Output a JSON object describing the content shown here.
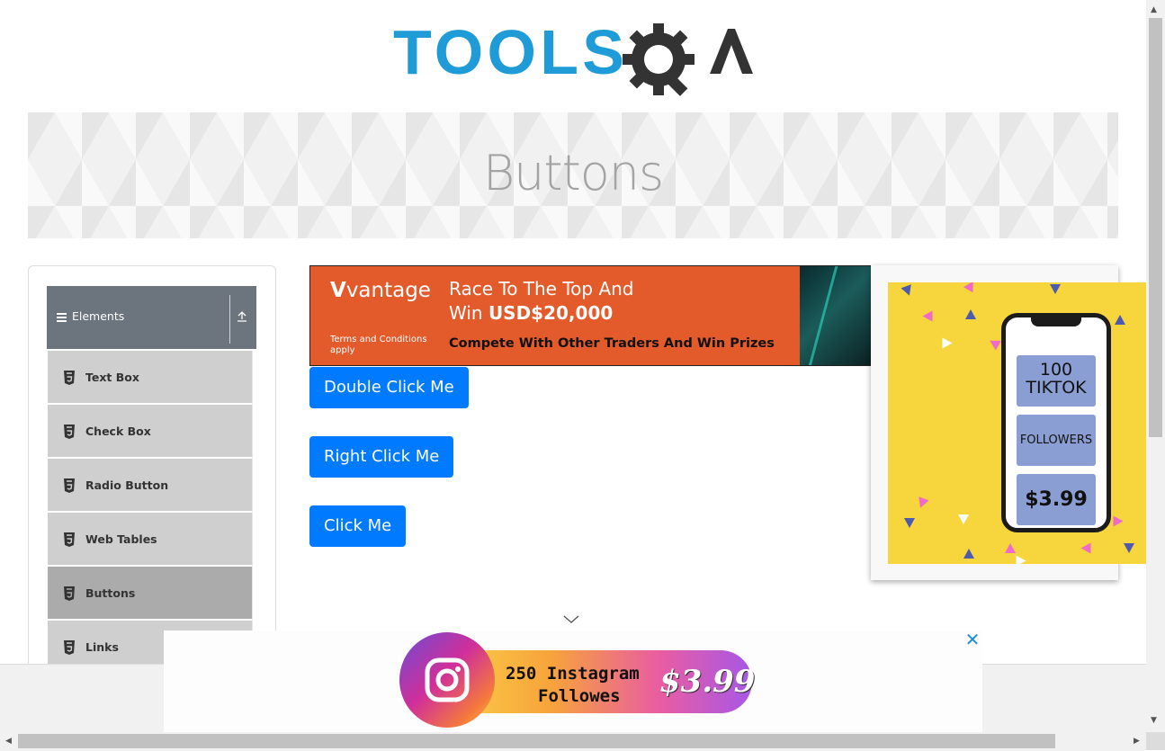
{
  "header": {
    "logo_text": "TOOLSQA"
  },
  "banner": {
    "title": "Buttons"
  },
  "sidebar": {
    "group": {
      "label": "Elements"
    },
    "items": [
      {
        "label": "Text Box"
      },
      {
        "label": "Check Box"
      },
      {
        "label": "Radio Button"
      },
      {
        "label": "Web Tables"
      },
      {
        "label": "Buttons",
        "active": true
      },
      {
        "label": "Links"
      }
    ]
  },
  "ads": {
    "vantage": {
      "brand": "vantage",
      "headline_line1": "Race To The Top And",
      "headline_line2_prefix": "Win ",
      "headline_line2_bold": "USD$20,000",
      "terms": "Terms and Conditions apply",
      "subline": "Compete With Other Traders And Win Prizes"
    },
    "tiktok": {
      "line1": "100",
      "line2": "TIKTOK",
      "card2": "FOLLOWERS",
      "price": "$3.99"
    },
    "instagram": {
      "text_line1": "250 Instagram",
      "text_line2": "Followes",
      "price": "$3.99",
      "close": "✕"
    }
  },
  "buttons": {
    "double_click": "Double Click Me",
    "right_click": "Right Click Me",
    "click": "Click Me"
  },
  "colors": {
    "primary": "#007bff",
    "sidebar_header": "#6c757d",
    "menu_item": "#cfcfcf",
    "menu_active": "#ababab"
  }
}
